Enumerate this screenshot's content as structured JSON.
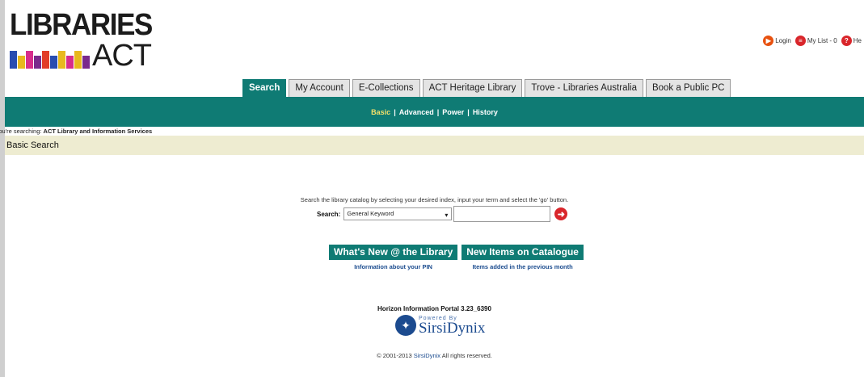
{
  "logo": {
    "top_text": "LIBRARIES",
    "bottom_text": "ACT",
    "bar_colors": [
      "#2a4db0",
      "#e8b81e",
      "#d72d8c",
      "#7a2a8c",
      "#e23d28",
      "#2a4db0",
      "#e8b81e",
      "#d72d8c",
      "#e8b81e",
      "#7a2a8c"
    ]
  },
  "top_links": {
    "login": "Login",
    "my_list": "My List - 0",
    "help": "He"
  },
  "tabs": [
    {
      "label": "Search",
      "active": true
    },
    {
      "label": "My Account"
    },
    {
      "label": "E-Collections"
    },
    {
      "label": "ACT Heritage Library"
    },
    {
      "label": "Trove - Libraries Australia"
    },
    {
      "label": "Book a Public PC"
    }
  ],
  "subnav": [
    "Basic",
    "Advanced",
    "Power",
    "History"
  ],
  "searching": {
    "prefix": "You're searching:",
    "scope": "ACT Library and Information Services"
  },
  "basic_search_title": "Basic Search",
  "instructions": "Search the library catalog by selecting your desired index, input your term and select the 'go' button.",
  "search": {
    "label": "Search:",
    "index_value": "General Keyword",
    "term_value": ""
  },
  "buttons": [
    {
      "label": "What's New @ the Library",
      "sub": "Information about your PIN"
    },
    {
      "label": "New Items on Catalogue",
      "sub": "Items added in the previous month"
    }
  ],
  "footer": {
    "portal_version": "Horizon Information Portal 3.23_6390",
    "powered_by": "Powered By",
    "vendor": "SirsiDynix",
    "copyright_prefix": "© 2001-2013 ",
    "copyright_link": "SirsiDynix",
    "copyright_suffix": " All rights reserved."
  }
}
